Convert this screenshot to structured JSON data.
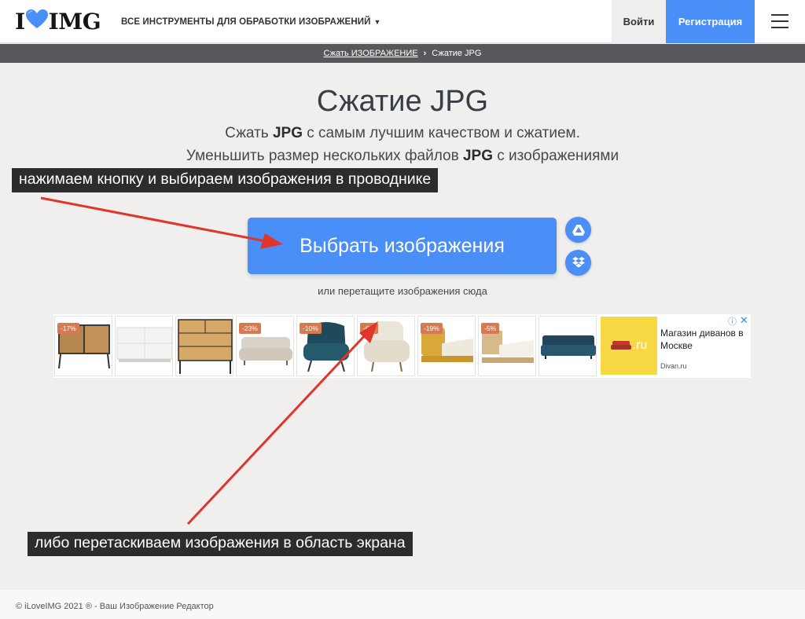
{
  "header": {
    "logo_i": "I",
    "logo_img": "IMG",
    "tools_menu_label": "ВСЕ ИНСТРУМЕНТЫ ДЛЯ ОБРАБОТКИ ИЗОБРАЖЕНИЙ",
    "login_label": "Войти",
    "register_label": "Регистрация"
  },
  "breadcrumb": {
    "parent": "Сжать ИЗОБРАЖЕНИЕ",
    "current": "Сжатие JPG"
  },
  "main": {
    "title": "Сжатие JPG",
    "subtitle_line1": {
      "pre": "Сжать ",
      "bold": "JPG",
      "post": " с самым лучшим качеством и сжатием."
    },
    "subtitle_line2": {
      "pre": "Уменьшить размер нескольких файлов ",
      "bold": "JPG",
      "post": " с изображениями"
    },
    "select_button_label": "Выбрать изображения",
    "drop_hint": "или перетащите изображения сюда"
  },
  "ad": {
    "items": [
      {
        "discount": "-17%",
        "icon": "sideboard-icon"
      },
      {
        "discount": "",
        "icon": "white-dresser-icon"
      },
      {
        "discount": "",
        "icon": "wood-chest-icon"
      },
      {
        "discount": "-23%",
        "icon": "beige-sofa-icon"
      },
      {
        "discount": "-10%",
        "icon": "teal-armchair-icon"
      },
      {
        "discount": "-6%",
        "icon": "cream-armchair-icon"
      },
      {
        "discount": "-19%",
        "icon": "yellow-bed-icon"
      },
      {
        "discount": "-5%",
        "icon": "wood-bed-icon"
      },
      {
        "discount": "",
        "icon": "blue-sofa-icon"
      }
    ],
    "promo_ru": ".ru",
    "text": "Магазин диванов в Москве",
    "domain": "Divan.ru"
  },
  "annotations": {
    "note1": "нажимаем кнопку и выбираем изображения в проводнике",
    "note2": "либо перетаскиваем изображения в область экрана"
  },
  "footer": {
    "text": "© iLoveIMG 2021 ® - Ваш Изображение Редактор"
  },
  "colors": {
    "accent": "#4a8ef7",
    "background": "#f0efed",
    "breadcrumb_bar": "#57585c",
    "annotation_arrow": "#e0352b",
    "annotation_bg": "#2c2c2c",
    "discount_tag": "#d77a52"
  }
}
